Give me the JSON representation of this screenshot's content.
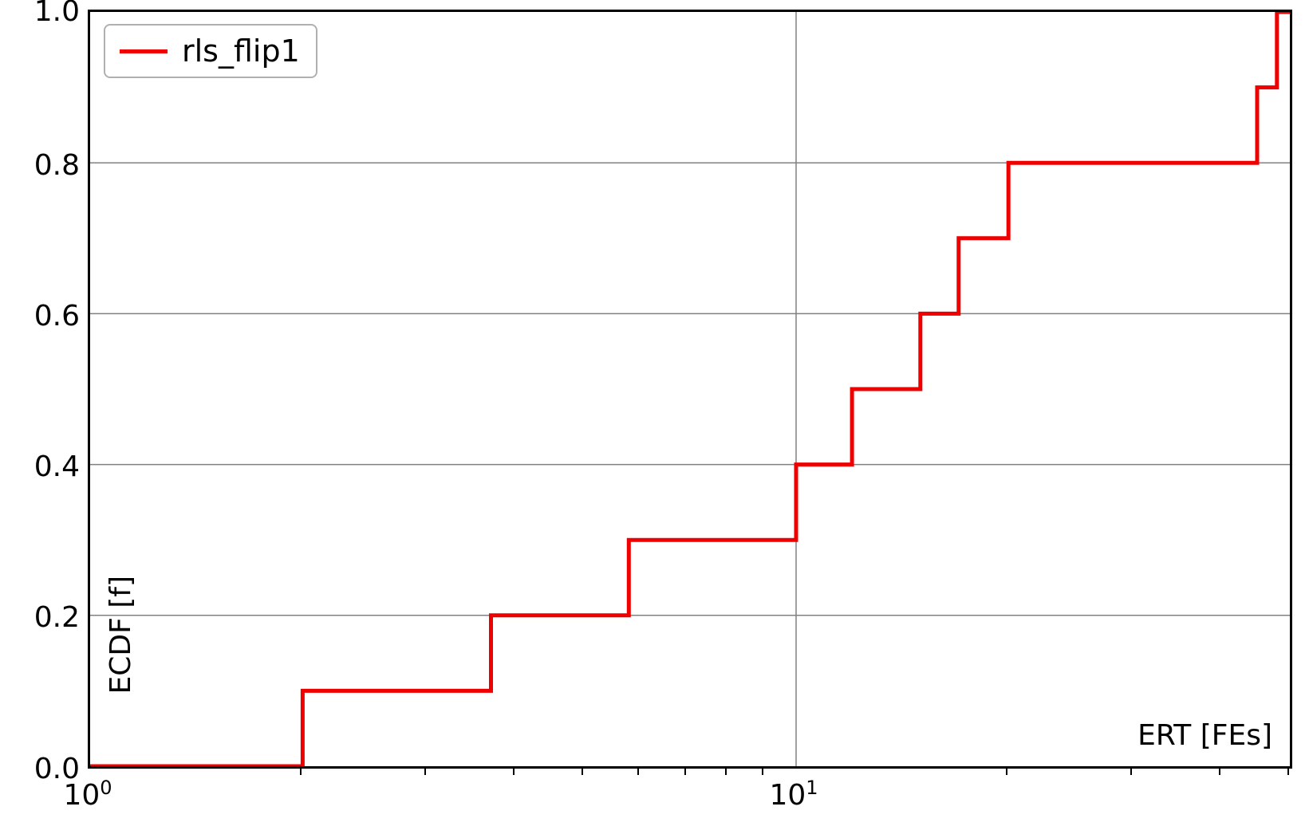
{
  "chart_data": {
    "type": "line",
    "title": "",
    "xlabel": "ERT [FEs]",
    "ylabel": "ECDF [f]",
    "x_scale": "log",
    "xlim": [
      1,
      50
    ],
    "ylim": [
      0.0,
      1.0
    ],
    "y_ticks": [
      0.0,
      0.2,
      0.4,
      0.6,
      0.8,
      1.0
    ],
    "x_tick_labels": [
      "10^0",
      "10^1"
    ],
    "x_tick_values": [
      1,
      10
    ],
    "series": [
      {
        "name": "rls_flip1",
        "color": "#ee0000",
        "step_style": "post",
        "x": [
          1,
          2,
          3.7,
          5.8,
          10,
          12,
          15,
          17,
          20,
          45,
          48,
          50
        ],
        "y": [
          0.0,
          0.1,
          0.2,
          0.3,
          0.4,
          0.5,
          0.6,
          0.7,
          0.8,
          0.8,
          0.9,
          1.0
        ]
      }
    ]
  },
  "legend": {
    "items": [
      {
        "label": "rls_flip1"
      }
    ]
  },
  "axes": {
    "x_inline_label": "ERT [FEs]",
    "y_inline_label": "ECDF [f]"
  },
  "ticks": {
    "y": [
      "0.0",
      "0.2",
      "0.4",
      "0.6",
      "0.8",
      "1.0"
    ],
    "x": [
      {
        "value": 1,
        "base": "10",
        "exp": "0"
      },
      {
        "value": 10,
        "base": "10",
        "exp": "1"
      }
    ]
  }
}
